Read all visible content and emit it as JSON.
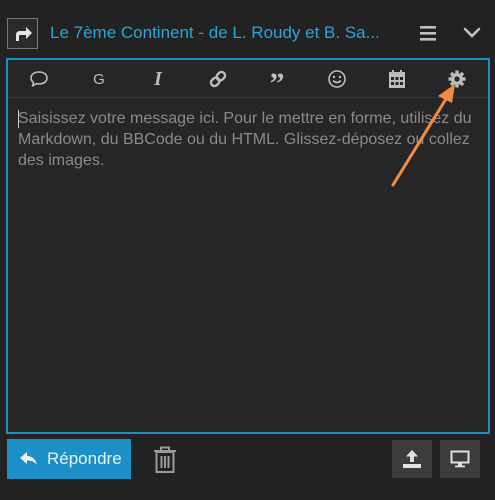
{
  "header": {
    "title": "Le 7ème Continent - de L. Roudy et B. Sa...",
    "reply_icon": "reply-arrow-icon",
    "menu_icon": "hamburger-icon",
    "collapse_icon": "chevron-down-icon"
  },
  "toolbar": {
    "items": [
      {
        "name": "quote-bubble-icon"
      },
      {
        "name": "g-icon",
        "label": "G"
      },
      {
        "name": "italic-icon",
        "label": "I"
      },
      {
        "name": "link-icon"
      },
      {
        "name": "blockquote-icon",
        "label": "”"
      },
      {
        "name": "emoji-icon"
      },
      {
        "name": "calendar-icon"
      },
      {
        "name": "gear-icon"
      }
    ]
  },
  "editor": {
    "placeholder": "Saisissez votre message ici. Pour le mettre en forme, utilisez du Markdown, du BBCode ou du HTML. Glissez-déposez ou collez des images."
  },
  "footer": {
    "reply_label": "Répondre",
    "trash_icon": "trash-icon",
    "upload_icon": "upload-icon",
    "preview_icon": "monitor-icon"
  },
  "colors": {
    "background": "#222222",
    "accent": "#1d8fc7",
    "title": "#28a6d9",
    "annotation_arrow": "#f28c44"
  }
}
